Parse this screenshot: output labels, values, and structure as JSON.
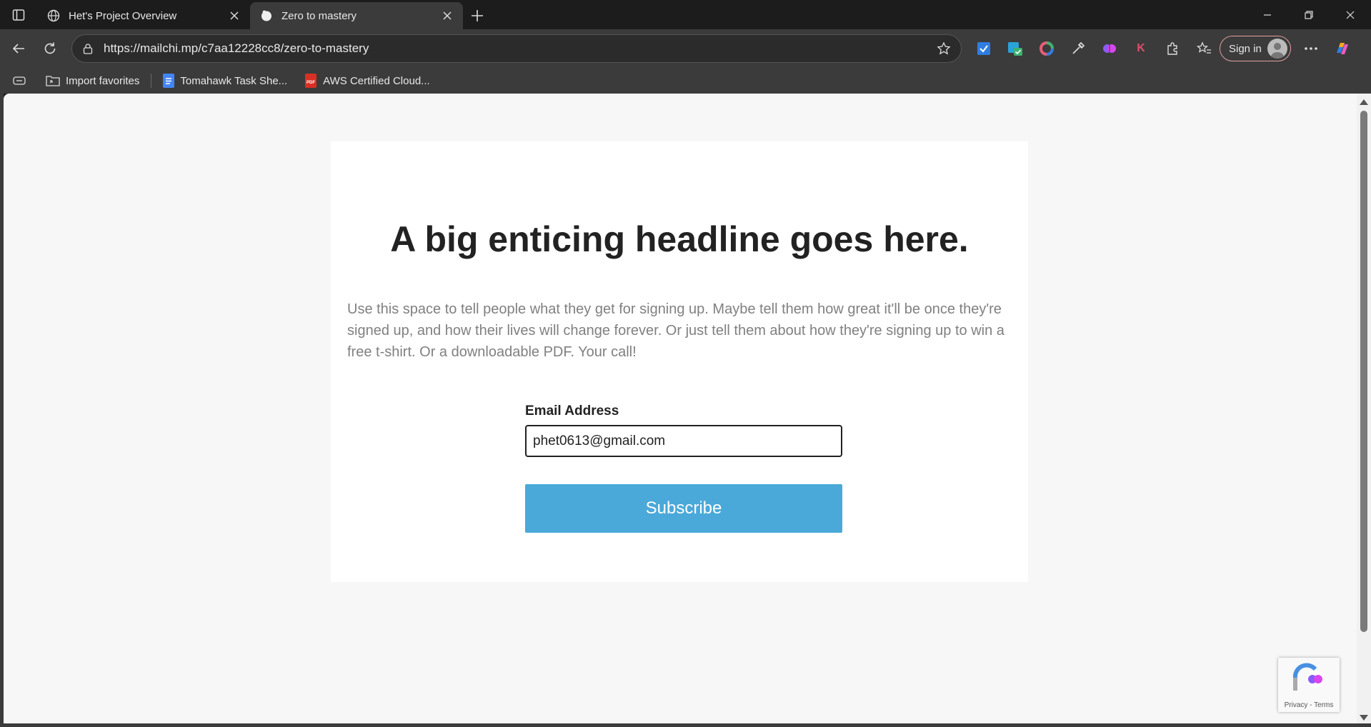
{
  "browser": {
    "tabs": [
      {
        "title": "Het's Project Overview",
        "icon": "globe-icon",
        "active": false
      },
      {
        "title": "Zero to mastery",
        "icon": "mailchimp-icon",
        "active": true
      }
    ],
    "address": "https://mailchi.mp/c7aa12228cc8/zero-to-mastery",
    "signin_label": "Sign in",
    "bookmarks": [
      {
        "label": "Import favorites",
        "icon": "import-folder-icon"
      },
      {
        "label": "Tomahawk Task She...",
        "icon": "google-docs-icon"
      },
      {
        "label": "AWS Certified Cloud...",
        "icon": "pdf-icon"
      }
    ]
  },
  "page": {
    "headline": "A big enticing headline goes here.",
    "body": "Use this space to tell people what they get for signing up. Maybe tell them how great it'll be once they're signed up, and how their lives will change forever. Or just tell them about how they're signing up to win a free t-shirt. Or a downloadable PDF. Your call!",
    "email_label": "Email Address",
    "email_value": "phet0613@gmail.com",
    "subscribe_label": "Subscribe",
    "recaptcha_text": "Privacy - Terms"
  },
  "colors": {
    "button": "#4aa9d9",
    "page_bg": "#f7f7f7",
    "browser_chrome": "#3b3b3b"
  }
}
